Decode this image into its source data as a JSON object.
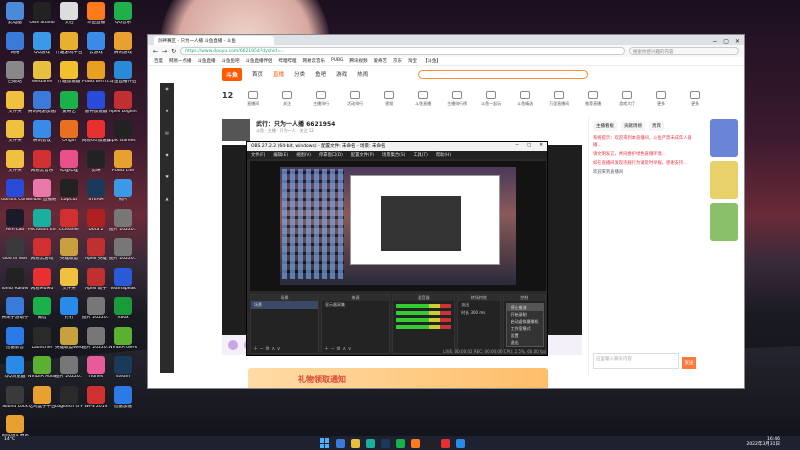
{
  "desktop": {
    "icons": [
      {
        "label": "此电脑",
        "color": "#4a8ad8"
      },
      {
        "label": "OBS Studio",
        "color": "#222"
      },
      {
        "label": "文档",
        "color": "#ddd"
      },
      {
        "label": "斗鱼直播",
        "color": "#ff7a1a"
      },
      {
        "label": "QQ音乐",
        "color": "#1fb04a"
      },
      {
        "label": "网络",
        "color": "#3a7ad8"
      },
      {
        "label": "QQ游戏",
        "color": "#3a9ae8"
      },
      {
        "label": "什趣游戏平台",
        "color": "#e8b030"
      },
      {
        "label": "云游戏",
        "color": "#3a8ae8"
      },
      {
        "label": "腾讯游戏",
        "color": "#e8a030"
      },
      {
        "label": "回收站",
        "color": "#888"
      },
      {
        "label": "WeGame",
        "color": "#e8c040"
      },
      {
        "label": "什趣加速器",
        "color": "#f0c030"
      },
      {
        "label": "PUBG BATTLEGR...",
        "color": "#e8a020"
      },
      {
        "label": "斗鱼直播伴侣",
        "color": "#2a8ad8"
      },
      {
        "label": "文件夹",
        "color": "#f0c040"
      },
      {
        "label": "腾讯网游加速器",
        "color": "#3a7ad8"
      },
      {
        "label": "爱奇艺",
        "color": "#1ab04a"
      },
      {
        "label": "雷神加速器",
        "color": "#2a4ad8"
      },
      {
        "label": "Apex Legends",
        "color": "#c03030"
      },
      {
        "label": "文件夹",
        "color": "#f0c040"
      },
      {
        "label": "腾讯会议",
        "color": "#3a8ae8"
      },
      {
        "label": "Origin",
        "color": "#e87020"
      },
      {
        "label": "网易UU加速器",
        "color": "#e83030"
      },
      {
        "label": "Epic Games Launcher",
        "color": "#222"
      },
      {
        "label": "文件夹",
        "color": "#f0c040"
      },
      {
        "label": "网易云音乐",
        "color": "#d03030"
      },
      {
        "label": "哔哩哔哩",
        "color": "#e8508a"
      },
      {
        "label": "剪映",
        "color": "#222"
      },
      {
        "label": "PUBG Lite",
        "color": "#e8a030"
      },
      {
        "label": "Ubisoft Connect",
        "color": "#2a4ad8"
      },
      {
        "label": "Bilibili 直播姬",
        "color": "#e878a8"
      },
      {
        "label": "CapCut",
        "color": "#222"
      },
      {
        "label": "STEAM",
        "color": "#1a3a5a"
      },
      {
        "label": "照片",
        "color": "#3a9ae8"
      },
      {
        "label": "Aim Lab",
        "color": "#1a1a2a"
      },
      {
        "label": "Microsoft Edge",
        "color": "#1ab0a0"
      },
      {
        "label": "CCleaner",
        "color": "#d03030"
      },
      {
        "label": "Dota 2",
        "color": "#b02020"
      },
      {
        "label": "图片 20220...",
        "color": "#777"
      },
      {
        "label": "God of War",
        "color": "#3a3a3a"
      },
      {
        "label": "网易云游戏",
        "color": "#d03030"
      },
      {
        "label": "英雄联盟",
        "color": "#c8a040"
      },
      {
        "label": "Apex 英雄",
        "color": "#c03030"
      },
      {
        "label": "图片 20220...",
        "color": "#777"
      },
      {
        "label": "Tomb Raider",
        "color": "#222"
      },
      {
        "label": "网易MuMu",
        "color": "#e83030"
      },
      {
        "label": "文件夹",
        "color": "#f0c040"
      },
      {
        "label": "Apex 助手",
        "color": "#c03030"
      },
      {
        "label": "TeamSpeak",
        "color": "#2a5ad8"
      },
      {
        "label": "腾讯手游助手",
        "color": "#3a7ad8"
      },
      {
        "label": "微信",
        "color": "#1ab04a"
      },
      {
        "label": "钉钉",
        "color": "#2a8ae8"
      },
      {
        "label": "图片 20220...",
        "color": "#777"
      },
      {
        "label": "Xbox",
        "color": "#1a9a3a"
      },
      {
        "label": "迅雷影音",
        "color": "#2a7ae8"
      },
      {
        "label": "Launcher",
        "color": "#2a2a2a"
      },
      {
        "label": "英雄联盟WeGame版",
        "color": "#c8a040"
      },
      {
        "label": "图片 20220...",
        "color": "#777"
      },
      {
        "label": "NVIDIA GeForce Experience",
        "color": "#5ab030"
      },
      {
        "label": "QQ浏览器",
        "color": "#2a8ae8"
      },
      {
        "label": "NVIDIA Audio",
        "color": "#5ab030"
      },
      {
        "label": "图片 20220...",
        "color": "#777"
      },
      {
        "label": "iTunes",
        "color": "#e85a9a"
      },
      {
        "label": "steam",
        "color": "#1a3a5a"
      },
      {
        "label": "Sound Lock",
        "color": "#3a3a3a"
      },
      {
        "label": "吃鸡盒子平台",
        "color": "#e8a030"
      },
      {
        "label": "Logitech G HUB",
        "color": "#2a2a2a"
      },
      {
        "label": "WPS 2019",
        "color": "#d03030"
      },
      {
        "label": "迅雷加速",
        "color": "#2a7ae8"
      },
      {
        "label": "Tencent 腾讯平台",
        "color": "#e8a030"
      }
    ]
  },
  "browser": {
    "tab_title": "剑神赛区 - 只为一人播 斗鱼直播 - 斗鱼",
    "url": "https://www.douyu.com/6621954?dyshid=...",
    "search_placeholder": "搜索你感兴趣的内容",
    "bookmarks": [
      "百度",
      "网易一点播",
      "斗鱼直播",
      "斗鱼鱼吧",
      "斗鱼直播伴侣",
      "哔哩哔哩",
      "网易云音乐",
      "PUBG",
      "腾讯视频",
      "爱奇艺",
      "京东",
      "淘宝",
      "【斗鱼】"
    ],
    "site": {
      "logo": "斗鱼",
      "nav": [
        "首页",
        "直播",
        "分类",
        "鱼吧",
        "游戏",
        "热闹"
      ],
      "nav_active_index": 1,
      "follow_count": "12",
      "categories": [
        "直播间",
        "关注",
        "主播排行",
        "活动排行",
        "视频",
        "斗鱼直播",
        "主播排行榜",
        "斗鱼一起玩",
        "斗鱼精选",
        "万里直播间",
        "推荐直播",
        "游戏大厅",
        "更多",
        "更多"
      ]
    },
    "stream": {
      "title": "武行：只为一人播 6621954",
      "subtitle": "斗鱼 · 主播 · 只为一人 · 关注 12"
    },
    "banner_text": "礼物领取通知",
    "chat": {
      "tabs": [
        "主播看板",
        "贡献周榜",
        "贵宾"
      ],
      "messages": [
        {
          "text": "系统提示：欢迎来到本直播间，斗鱼严禁未成年人直播...",
          "red": true
        },
        {
          "text": "请文明发言，共同维护绿色直播环境...",
          "red": true
        },
        {
          "text": "如在直播间发现违规行为请及时举报，感谢支持...",
          "red": true
        },
        {
          "text": "欢迎来到直播间",
          "red": false
        }
      ],
      "input_placeholder": "这里输入聊天内容",
      "send_label": "发送"
    }
  },
  "obs": {
    "title": "OBS 27.2.2 (64-bit, windows) - 配置文件: 未命名 - 场景: 未命名",
    "menu": [
      "文件(F)",
      "编辑(E)",
      "视图(V)",
      "停靠窗口(D)",
      "配置文件(P)",
      "场景集合(S)",
      "工具(T)",
      "帮助(H)"
    ],
    "docks": {
      "scenes": {
        "header": "场景",
        "items": [
          "场景"
        ]
      },
      "sources": {
        "header": "来源",
        "items": [
          "显示器采集"
        ]
      },
      "mixer": {
        "header": "混音器"
      },
      "transitions": {
        "header": "转场特效",
        "items": [
          "淡出",
          "时长 300 ms"
        ]
      },
      "controls": {
        "header": "控制"
      }
    },
    "context_menu": [
      "停止推流",
      "开始录制",
      "启动虚拟摄像机",
      "工作室模式",
      "设置",
      "退出"
    ],
    "context_menu_highlight": 0,
    "status": "LIVE: 00:00:02  REC: 00:00:00  CPU: 2.5%, 60.00 fps"
  },
  "taskbar": {
    "weather": "14°C",
    "time": "16:46",
    "date": "2022年3月31日"
  }
}
